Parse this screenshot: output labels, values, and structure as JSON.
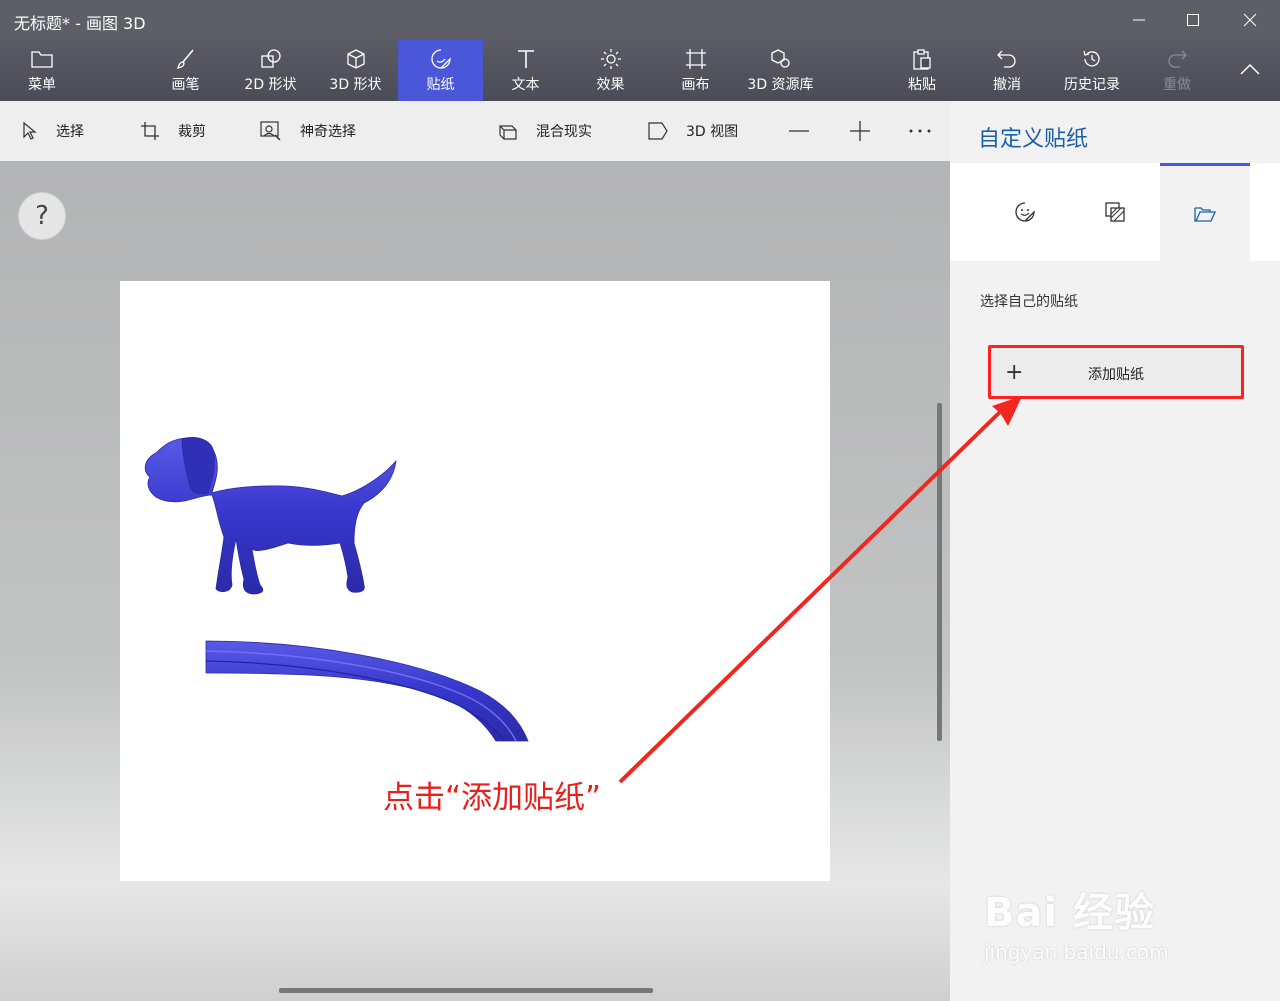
{
  "window": {
    "title": "无标题* - 画图 3D"
  },
  "ribbon": {
    "menu": "菜单",
    "tools": [
      "画笔",
      "2D 形状",
      "3D 形状",
      "贴纸",
      "文本",
      "效果",
      "画布",
      "3D 资源库"
    ],
    "active_tool": "贴纸",
    "paste": "粘贴",
    "undo": "撤消",
    "history": "历史记录",
    "redo": "重做"
  },
  "toolbar": {
    "select": "选择",
    "crop": "裁剪",
    "magic_select": "神奇选择",
    "mixed_reality": "混合现实",
    "view_3d": "3D 视图"
  },
  "help": "?",
  "panel": {
    "title": "自定义贴纸",
    "subtitle": "选择自己的贴纸",
    "add_plus": "+",
    "add_sticker": "添加贴纸"
  },
  "annotation": "点击“添加贴纸”",
  "watermark": {
    "brand": "Bai 经验",
    "url": "jingyan.baidu.com"
  },
  "colors": {
    "accent": "#4b57d9",
    "annotation": "#e8201c",
    "shape_blue": "#3b3bd4"
  }
}
